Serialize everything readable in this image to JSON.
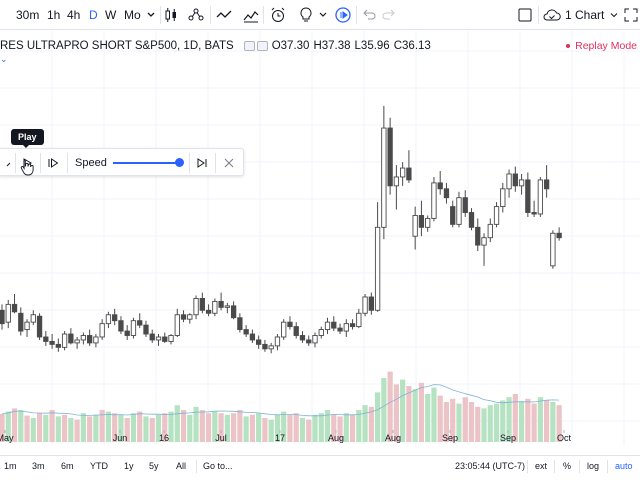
{
  "toolbar": {
    "timeframes": [
      "30m",
      "1h",
      "4h",
      "D",
      "W",
      "Mo"
    ],
    "active_timeframe": "D",
    "icons": [
      "dropdown-chevron-icon",
      "candles-icon",
      "indicators-icon",
      "line-icon",
      "compare-icon",
      "alert-icon",
      "light-bulb-icon",
      "replay-icon",
      "undo-icon",
      "redo-icon",
      "layout-icon",
      "cloud-save-icon",
      "fullscreen-icon"
    ],
    "layout_label": "1 Chart"
  },
  "legend": {
    "title": "RES ULTRAPRO SHORT S&P500, 1D, BATS",
    "open": "O37.30",
    "high": "H37.38",
    "low": "L35.96",
    "close": "C36.13",
    "replay_mode": "Replay Mode"
  },
  "replay_panel": {
    "tooltip": "Play",
    "speed_label": "Speed",
    "speed_level": 1.0,
    "buttons": [
      "play-button",
      "step-forward-button",
      "jump-to-realtime-button",
      "close-button"
    ]
  },
  "x_axis": {
    "labels": [
      "May",
      "Jun",
      "16",
      "Jul",
      "17",
      "Aug",
      "Aug",
      "Sep",
      "Sep",
      "Oct"
    ]
  },
  "bottombar": {
    "ranges": [
      "1m",
      "3m",
      "6m",
      "YTD",
      "1y",
      "5y",
      "All",
      "Go to..."
    ],
    "clock": "23:05:44 (UTC-7)",
    "options": [
      "ext",
      "%",
      "log",
      "auto"
    ],
    "active_option": "auto"
  },
  "colors": {
    "up": "#4a4a4a",
    "up_fill": "#ffffff",
    "down": "#4a4a4a",
    "vol_up": "#b5e3c1",
    "vol_down": "#ecc3c6",
    "accent": "#2962ff",
    "replay": "#e0315d"
  },
  "chart_data": {
    "type": "candlestick",
    "candles": [
      {
        "o": 37.2,
        "h": 37.6,
        "l": 35.9,
        "c": 36.3
      },
      {
        "o": 36.4,
        "h": 37.9,
        "l": 36.0,
        "c": 37.6
      },
      {
        "o": 37.6,
        "h": 38.3,
        "l": 37.0,
        "c": 37.1
      },
      {
        "o": 37.0,
        "h": 37.4,
        "l": 35.5,
        "c": 35.8
      },
      {
        "o": 35.9,
        "h": 36.6,
        "l": 35.4,
        "c": 36.4
      },
      {
        "o": 36.4,
        "h": 37.2,
        "l": 36.2,
        "c": 36.9
      },
      {
        "o": 36.8,
        "h": 37.0,
        "l": 35.2,
        "c": 35.4
      },
      {
        "o": 35.4,
        "h": 35.8,
        "l": 34.8,
        "c": 35.1
      },
      {
        "o": 35.1,
        "h": 35.6,
        "l": 34.6,
        "c": 34.9
      },
      {
        "o": 34.9,
        "h": 35.3,
        "l": 34.4,
        "c": 34.7
      },
      {
        "o": 34.7,
        "h": 35.8,
        "l": 34.5,
        "c": 35.6
      },
      {
        "o": 35.6,
        "h": 36.0,
        "l": 34.9,
        "c": 35.0
      },
      {
        "o": 35.0,
        "h": 35.4,
        "l": 34.6,
        "c": 35.2
      },
      {
        "o": 35.2,
        "h": 35.7,
        "l": 34.9,
        "c": 35.5
      },
      {
        "o": 35.5,
        "h": 35.9,
        "l": 34.8,
        "c": 35.0
      },
      {
        "o": 35.0,
        "h": 35.6,
        "l": 34.7,
        "c": 35.4
      },
      {
        "o": 35.4,
        "h": 36.6,
        "l": 35.2,
        "c": 36.3
      },
      {
        "o": 36.3,
        "h": 37.1,
        "l": 36.0,
        "c": 36.9
      },
      {
        "o": 36.9,
        "h": 37.3,
        "l": 36.2,
        "c": 36.5
      },
      {
        "o": 36.5,
        "h": 36.8,
        "l": 35.6,
        "c": 35.8
      },
      {
        "o": 35.8,
        "h": 36.2,
        "l": 35.2,
        "c": 35.5
      },
      {
        "o": 35.5,
        "h": 36.7,
        "l": 35.3,
        "c": 36.5
      },
      {
        "o": 36.5,
        "h": 37.0,
        "l": 36.0,
        "c": 36.2
      },
      {
        "o": 36.2,
        "h": 36.5,
        "l": 35.4,
        "c": 35.6
      },
      {
        "o": 35.6,
        "h": 35.9,
        "l": 35.0,
        "c": 35.2
      },
      {
        "o": 35.2,
        "h": 35.6,
        "l": 34.8,
        "c": 35.4
      },
      {
        "o": 35.4,
        "h": 35.7,
        "l": 35.0,
        "c": 35.1
      },
      {
        "o": 35.1,
        "h": 35.6,
        "l": 34.9,
        "c": 35.5
      },
      {
        "o": 35.5,
        "h": 37.3,
        "l": 35.4,
        "c": 36.9
      },
      {
        "o": 36.9,
        "h": 37.2,
        "l": 36.4,
        "c": 36.6
      },
      {
        "o": 36.6,
        "h": 37.0,
        "l": 36.3,
        "c": 36.9
      },
      {
        "o": 36.9,
        "h": 38.2,
        "l": 36.6,
        "c": 38.0
      },
      {
        "o": 38.0,
        "h": 38.4,
        "l": 37.0,
        "c": 37.2
      },
      {
        "o": 37.2,
        "h": 37.6,
        "l": 36.8,
        "c": 37.0
      },
      {
        "o": 37.0,
        "h": 38.0,
        "l": 36.8,
        "c": 37.8
      },
      {
        "o": 37.8,
        "h": 38.4,
        "l": 37.2,
        "c": 37.4
      },
      {
        "o": 37.4,
        "h": 37.7,
        "l": 37.0,
        "c": 37.5
      },
      {
        "o": 37.5,
        "h": 37.8,
        "l": 36.6,
        "c": 36.7
      },
      {
        "o": 36.7,
        "h": 37.0,
        "l": 35.7,
        "c": 35.9
      },
      {
        "o": 35.9,
        "h": 36.2,
        "l": 35.4,
        "c": 35.6
      },
      {
        "o": 35.6,
        "h": 35.9,
        "l": 35.0,
        "c": 35.2
      },
      {
        "o": 35.2,
        "h": 35.5,
        "l": 34.6,
        "c": 34.9
      },
      {
        "o": 34.9,
        "h": 35.2,
        "l": 34.4,
        "c": 34.6
      },
      {
        "o": 34.6,
        "h": 35.0,
        "l": 34.3,
        "c": 34.8
      },
      {
        "o": 34.8,
        "h": 35.6,
        "l": 34.5,
        "c": 35.4
      },
      {
        "o": 35.4,
        "h": 36.6,
        "l": 35.2,
        "c": 36.4
      },
      {
        "o": 36.4,
        "h": 36.8,
        "l": 35.9,
        "c": 36.1
      },
      {
        "o": 36.1,
        "h": 36.4,
        "l": 35.3,
        "c": 35.5
      },
      {
        "o": 35.5,
        "h": 35.8,
        "l": 35.0,
        "c": 35.2
      },
      {
        "o": 35.2,
        "h": 35.5,
        "l": 34.8,
        "c": 35.0
      },
      {
        "o": 35.0,
        "h": 35.7,
        "l": 34.7,
        "c": 35.5
      },
      {
        "o": 35.5,
        "h": 36.1,
        "l": 35.3,
        "c": 35.9
      },
      {
        "o": 35.9,
        "h": 36.7,
        "l": 35.6,
        "c": 36.4
      },
      {
        "o": 36.4,
        "h": 36.8,
        "l": 35.8,
        "c": 36.0
      },
      {
        "o": 36.0,
        "h": 36.3,
        "l": 35.6,
        "c": 35.8
      },
      {
        "o": 35.8,
        "h": 36.6,
        "l": 35.4,
        "c": 36.3
      },
      {
        "o": 36.3,
        "h": 36.6,
        "l": 35.9,
        "c": 36.1
      },
      {
        "o": 36.1,
        "h": 37.3,
        "l": 36.0,
        "c": 37.0
      },
      {
        "o": 37.0,
        "h": 38.3,
        "l": 36.8,
        "c": 38.1
      },
      {
        "o": 38.1,
        "h": 38.4,
        "l": 36.9,
        "c": 37.2
      },
      {
        "o": 37.2,
        "h": 44.5,
        "l": 37.1,
        "c": 42.8
      },
      {
        "o": 42.8,
        "h": 51.0,
        "l": 42.0,
        "c": 49.5
      },
      {
        "o": 49.5,
        "h": 50.2,
        "l": 45.0,
        "c": 45.6
      },
      {
        "o": 45.6,
        "h": 47.0,
        "l": 44.0,
        "c": 46.2
      },
      {
        "o": 46.2,
        "h": 47.2,
        "l": 45.6,
        "c": 46.8
      },
      {
        "o": 46.8,
        "h": 48.0,
        "l": 45.8,
        "c": 46.0
      },
      {
        "o": 42.2,
        "h": 44.2,
        "l": 41.3,
        "c": 43.6
      },
      {
        "o": 43.6,
        "h": 44.6,
        "l": 42.2,
        "c": 42.8
      },
      {
        "o": 42.8,
        "h": 43.6,
        "l": 42.5,
        "c": 43.4
      },
      {
        "o": 43.4,
        "h": 46.2,
        "l": 43.2,
        "c": 45.8
      },
      {
        "o": 45.8,
        "h": 46.6,
        "l": 45.0,
        "c": 45.4
      },
      {
        "o": 45.4,
        "h": 45.8,
        "l": 44.4,
        "c": 44.8
      },
      {
        "o": 44.2,
        "h": 44.6,
        "l": 42.8,
        "c": 43.0
      },
      {
        "o": 43.0,
        "h": 45.2,
        "l": 42.8,
        "c": 44.8
      },
      {
        "o": 44.8,
        "h": 45.3,
        "l": 43.5,
        "c": 43.8
      },
      {
        "o": 43.8,
        "h": 44.1,
        "l": 42.6,
        "c": 42.8
      },
      {
        "o": 42.8,
        "h": 43.4,
        "l": 41.2,
        "c": 41.6
      },
      {
        "o": 41.6,
        "h": 42.4,
        "l": 40.2,
        "c": 42.1
      },
      {
        "o": 42.1,
        "h": 43.4,
        "l": 41.8,
        "c": 43.0
      },
      {
        "o": 43.0,
        "h": 44.5,
        "l": 42.8,
        "c": 44.2
      },
      {
        "o": 44.2,
        "h": 45.8,
        "l": 43.8,
        "c": 45.4
      },
      {
        "o": 45.4,
        "h": 46.7,
        "l": 44.8,
        "c": 46.4
      },
      {
        "o": 46.4,
        "h": 46.9,
        "l": 45.2,
        "c": 45.6
      },
      {
        "o": 45.6,
        "h": 46.4,
        "l": 45.0,
        "c": 46.0
      },
      {
        "o": 46.0,
        "h": 46.5,
        "l": 43.5,
        "c": 43.8
      },
      {
        "o": 43.8,
        "h": 44.6,
        "l": 43.5,
        "c": 43.7
      },
      {
        "o": 43.7,
        "h": 46.2,
        "l": 43.5,
        "c": 46.0
      },
      {
        "o": 46.0,
        "h": 47.0,
        "l": 44.8,
        "c": 45.4
      },
      {
        "o": 40.2,
        "h": 42.6,
        "l": 40.0,
        "c": 42.4
      },
      {
        "o": 42.4,
        "h": 42.8,
        "l": 41.9,
        "c": 42.1
      }
    ],
    "volume": [
      {
        "v": 0.35,
        "up": false
      },
      {
        "v": 0.38,
        "up": true
      },
      {
        "v": 0.42,
        "up": false
      },
      {
        "v": 0.4,
        "up": true
      },
      {
        "v": 0.33,
        "up": false
      },
      {
        "v": 0.3,
        "up": true
      },
      {
        "v": 0.36,
        "up": false
      },
      {
        "v": 0.34,
        "up": true
      },
      {
        "v": 0.4,
        "up": false
      },
      {
        "v": 0.32,
        "up": true
      },
      {
        "v": 0.34,
        "up": false
      },
      {
        "v": 0.3,
        "up": true
      },
      {
        "v": 0.28,
        "up": false
      },
      {
        "v": 0.36,
        "up": true
      },
      {
        "v": 0.32,
        "up": false
      },
      {
        "v": 0.34,
        "up": true
      },
      {
        "v": 0.4,
        "up": false
      },
      {
        "v": 0.38,
        "up": true
      },
      {
        "v": 0.36,
        "up": false
      },
      {
        "v": 0.34,
        "up": true
      },
      {
        "v": 0.3,
        "up": false
      },
      {
        "v": 0.36,
        "up": true
      },
      {
        "v": 0.38,
        "up": false
      },
      {
        "v": 0.32,
        "up": true
      },
      {
        "v": 0.3,
        "up": false
      },
      {
        "v": 0.34,
        "up": true
      },
      {
        "v": 0.36,
        "up": false
      },
      {
        "v": 0.38,
        "up": true
      },
      {
        "v": 0.46,
        "up": true
      },
      {
        "v": 0.4,
        "up": false
      },
      {
        "v": 0.34,
        "up": true
      },
      {
        "v": 0.44,
        "up": true
      },
      {
        "v": 0.4,
        "up": false
      },
      {
        "v": 0.36,
        "up": false
      },
      {
        "v": 0.38,
        "up": true
      },
      {
        "v": 0.36,
        "up": false
      },
      {
        "v": 0.34,
        "up": true
      },
      {
        "v": 0.36,
        "up": false
      },
      {
        "v": 0.4,
        "up": false
      },
      {
        "v": 0.32,
        "up": true
      },
      {
        "v": 0.34,
        "up": false
      },
      {
        "v": 0.36,
        "up": true
      },
      {
        "v": 0.3,
        "up": false
      },
      {
        "v": 0.28,
        "up": true
      },
      {
        "v": 0.34,
        "up": true
      },
      {
        "v": 0.38,
        "up": true
      },
      {
        "v": 0.34,
        "up": false
      },
      {
        "v": 0.36,
        "up": false
      },
      {
        "v": 0.3,
        "up": true
      },
      {
        "v": 0.28,
        "up": false
      },
      {
        "v": 0.34,
        "up": true
      },
      {
        "v": 0.36,
        "up": true
      },
      {
        "v": 0.4,
        "up": true
      },
      {
        "v": 0.34,
        "up": false
      },
      {
        "v": 0.32,
        "up": false
      },
      {
        "v": 0.36,
        "up": true
      },
      {
        "v": 0.34,
        "up": false
      },
      {
        "v": 0.4,
        "up": true
      },
      {
        "v": 0.46,
        "up": true
      },
      {
        "v": 0.44,
        "up": false
      },
      {
        "v": 0.62,
        "up": true
      },
      {
        "v": 0.8,
        "up": true
      },
      {
        "v": 0.88,
        "up": false
      },
      {
        "v": 0.72,
        "up": false
      },
      {
        "v": 0.78,
        "up": true
      },
      {
        "v": 0.7,
        "up": false
      },
      {
        "v": 0.66,
        "up": true
      },
      {
        "v": 0.74,
        "up": false
      },
      {
        "v": 0.6,
        "up": true
      },
      {
        "v": 0.68,
        "up": true
      },
      {
        "v": 0.58,
        "up": false
      },
      {
        "v": 0.5,
        "up": false
      },
      {
        "v": 0.54,
        "up": false
      },
      {
        "v": 0.48,
        "up": true
      },
      {
        "v": 0.56,
        "up": false
      },
      {
        "v": 0.5,
        "up": false
      },
      {
        "v": 0.44,
        "up": false
      },
      {
        "v": 0.42,
        "up": true
      },
      {
        "v": 0.46,
        "up": true
      },
      {
        "v": 0.48,
        "up": true
      },
      {
        "v": 0.52,
        "up": true
      },
      {
        "v": 0.56,
        "up": true
      },
      {
        "v": 0.6,
        "up": false
      },
      {
        "v": 0.5,
        "up": true
      },
      {
        "v": 0.54,
        "up": false
      },
      {
        "v": 0.48,
        "up": false
      },
      {
        "v": 0.56,
        "up": true
      },
      {
        "v": 0.52,
        "up": false
      },
      {
        "v": 0.5,
        "up": true
      },
      {
        "v": 0.46,
        "up": false
      }
    ],
    "ylim": [
      30,
      52
    ],
    "grid": true,
    "xlabel": "",
    "ylabel": ""
  }
}
